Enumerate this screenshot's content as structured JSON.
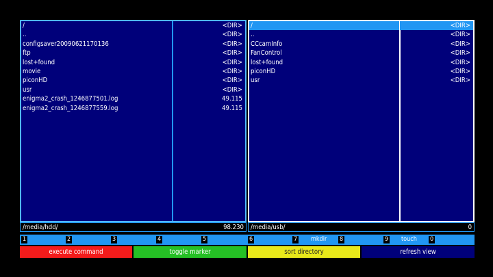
{
  "left_pane": {
    "names": [
      "/",
      "..",
      "configsaver20090621170136",
      "ftp",
      "lost+found",
      "movie",
      "piconHD",
      "usr",
      "enigma2_crash_1246877501.log",
      "enigma2_crash_1246877559.log"
    ],
    "sizes": [
      "<DIR>",
      "<DIR>",
      "<DIR>",
      "<DIR>",
      "<DIR>",
      "<DIR>",
      "<DIR>",
      "<DIR>",
      "49.115",
      "49.115"
    ],
    "path": "/media/hdd/",
    "free": "98.230"
  },
  "right_pane": {
    "names": [
      "/",
      "..",
      "CCcamInfo",
      "FanControl",
      "lost+found",
      "piconHD",
      "usr"
    ],
    "sizes": [
      "<DIR>",
      "<DIR>",
      "<DIR>",
      "<DIR>",
      "<DIR>",
      "<DIR>",
      "<DIR>"
    ],
    "path": "/media/usb/",
    "free": "0"
  },
  "number_keys": [
    "1",
    "2",
    "3",
    "4",
    "5",
    "6",
    "7",
    "8",
    "9",
    "0"
  ],
  "number_key_labels": {
    "key7": "mkdir",
    "key9": "touch"
  },
  "color_buttons": {
    "red": "execute command",
    "green": "toggle marker",
    "yellow": "sort directory",
    "blue": "refresh view"
  },
  "colors": {
    "background": "#000000",
    "pane": "#00007a",
    "accent": "#2196f3",
    "red": "#f31b1b",
    "green": "#25c025",
    "yellow": "#e8e81a",
    "blue": "#00007a"
  }
}
